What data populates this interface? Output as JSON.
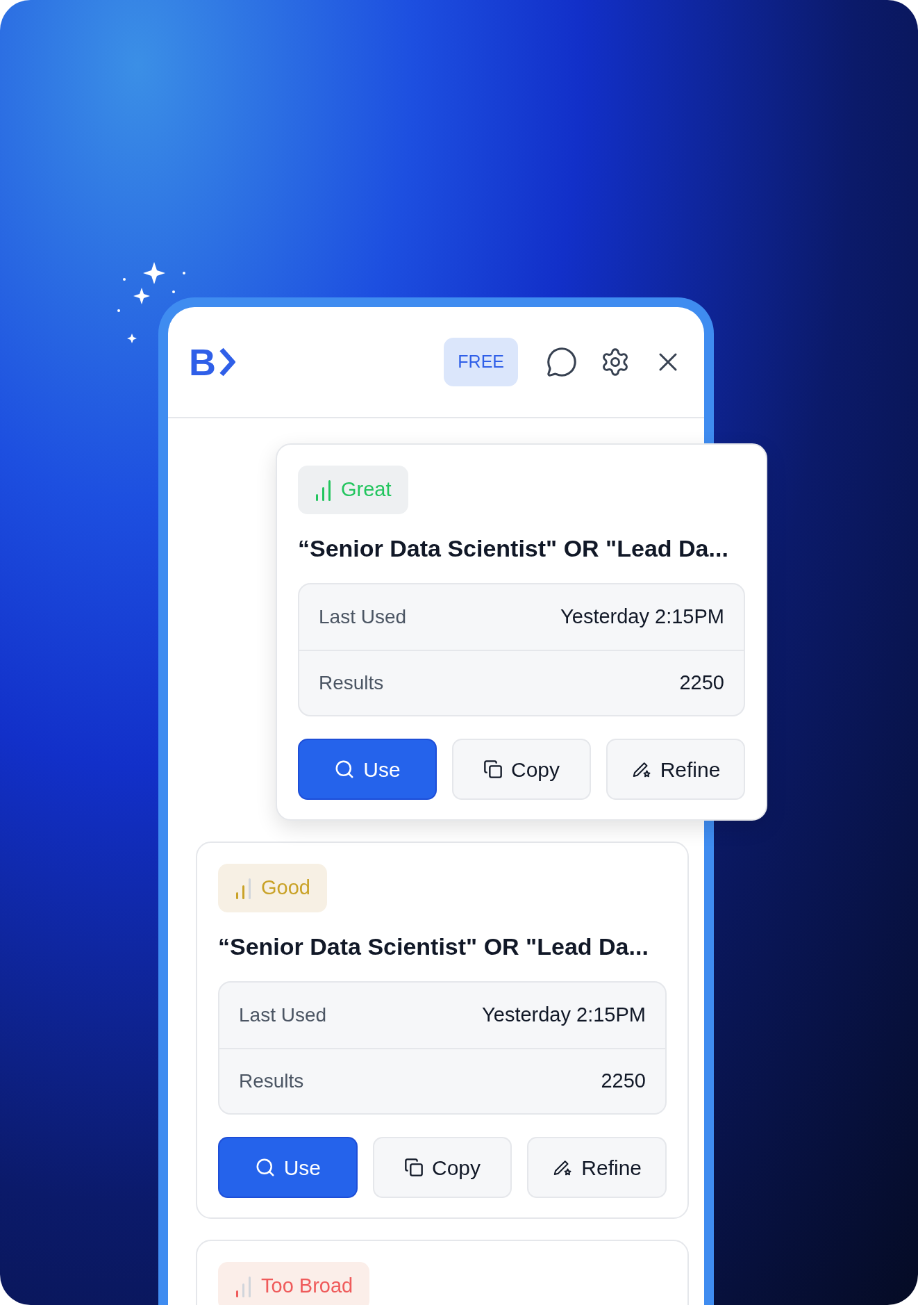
{
  "header": {
    "logo": "B",
    "plan_badge": "FREE"
  },
  "cards": [
    {
      "rating": {
        "kind": "great",
        "label": "Great",
        "color": "#22c55e"
      },
      "query": "“Senior Data Scientist\" OR \"Lead Da...",
      "rows": [
        {
          "label": "Last Used",
          "value": "Yesterday 2:15PM"
        },
        {
          "label": "Results",
          "value": "2250"
        }
      ],
      "buttons": [
        {
          "kind": "use",
          "label": "Use"
        },
        {
          "kind": "copy",
          "label": "Copy"
        },
        {
          "kind": "refine",
          "label": "Refine"
        }
      ]
    },
    {
      "rating": {
        "kind": "good",
        "label": "Good",
        "color": "#c9a227"
      },
      "query": "“Senior Data Scientist\" OR \"Lead Da...",
      "rows": [
        {
          "label": "Last Used",
          "value": "Yesterday 2:15PM"
        },
        {
          "label": "Results",
          "value": "2250"
        }
      ],
      "buttons": [
        {
          "kind": "use",
          "label": "Use"
        },
        {
          "kind": "copy",
          "label": "Copy"
        },
        {
          "kind": "refine",
          "label": "Refine"
        }
      ]
    },
    {
      "rating": {
        "kind": "too_broad",
        "label": "Too Broad",
        "color": "#ef5b5b"
      }
    }
  ]
}
